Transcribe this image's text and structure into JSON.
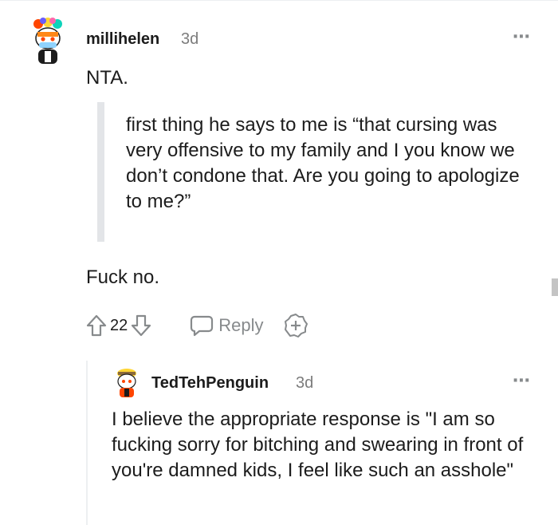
{
  "comment": {
    "author": "millihelen",
    "time": "3d",
    "more_icon": "⋯",
    "opening": "NTA.",
    "quote": "first thing he says to me is “that cursing was very offensive to my family and I you know we don’t condone that. Are you going to apologize to me?”",
    "closing": "Fuck no.",
    "score": "22",
    "reply_label": "Reply",
    "icons": {
      "upvote": "upvote-icon",
      "downvote": "downvote-icon",
      "reply": "speech-bubble-icon",
      "award": "award-plus-icon"
    }
  },
  "reply": {
    "author": "TedTehPenguin",
    "time": "3d",
    "more_icon": "⋯",
    "body": "I believe the appropriate response is \"I am so fucking sorry for bitching and swearing in front of you're damned kids, I feel like such an asshole\""
  },
  "colors": {
    "text": "#1c1c1c",
    "meta": "#7c7c7c",
    "icon": "#878a8c",
    "quote_bar": "#e3e5e8"
  }
}
